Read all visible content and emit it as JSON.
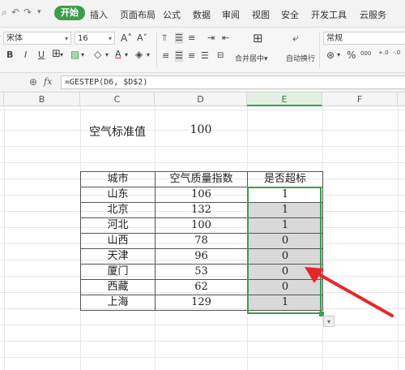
{
  "quick_access": [
    "↶",
    "↷",
    "▾"
  ],
  "menu_tabs": [
    "开始",
    "插入",
    "页面布局",
    "公式",
    "数据",
    "审阅",
    "视图",
    "安全",
    "开发工具",
    "云服务"
  ],
  "active_tab": "开始",
  "toolbar": {
    "font_name": "宋体",
    "font_size": "16",
    "font_grow": "A˄",
    "font_shrink": "A˅",
    "bold": "B",
    "italic": "I",
    "underline": "U",
    "merge_center_label": "合并居中",
    "auto_wrap_label": "自动换行",
    "number_format": "常规",
    "percent": "%",
    "thousands": "000",
    "inc_decimal": "+.0",
    "dec_decimal": "-.0"
  },
  "formula_bar": {
    "fx": "fx",
    "formula": "=GESTEP(D6, $D$2)"
  },
  "columns": [
    "B",
    "C",
    "D",
    "E",
    "F"
  ],
  "selected_column": "E",
  "standard": {
    "label": "空气标准值",
    "value": "100"
  },
  "table": {
    "headers": [
      "城市",
      "空气质量指数",
      "是否超标"
    ],
    "rows": [
      [
        "山东",
        "106",
        "1"
      ],
      [
        "北京",
        "132",
        "1"
      ],
      [
        "河北",
        "100",
        "1"
      ],
      [
        "山西",
        "78",
        "0"
      ],
      [
        "天津",
        "96",
        "0"
      ],
      [
        "厦门",
        "53",
        "0"
      ],
      [
        "西藏",
        "62",
        "0"
      ],
      [
        "上海",
        "129",
        "1"
      ]
    ]
  },
  "colors": {
    "accent": "#3c9e4c",
    "arrow": "#e8262a",
    "selection_fill": "#d9d9d9"
  }
}
